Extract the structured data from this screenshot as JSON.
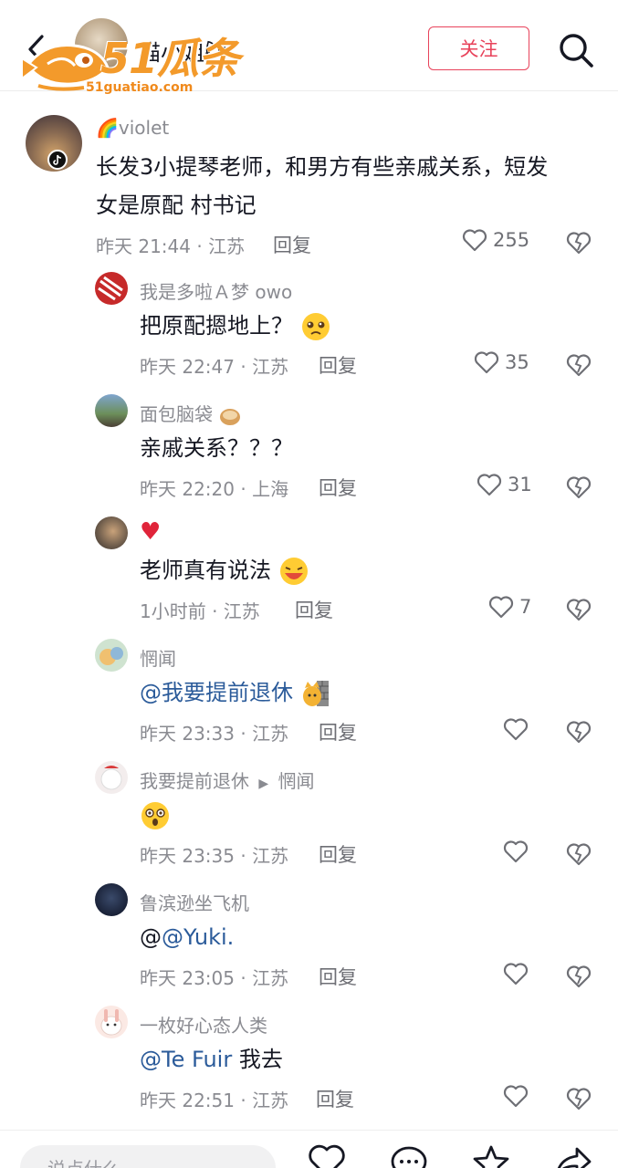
{
  "header": {
    "name": "猫小姐🐱",
    "follow_label": "关注",
    "watermark_big": "51瓜条",
    "watermark_small": "51guatiao.com"
  },
  "comments": [
    {
      "user": "🌈violet",
      "text": "长发3小提琴老师，和男方有些亲戚关系，短发",
      "text2": "女是原配 村书记",
      "time": "昨天 21:44 · 江苏",
      "reply": "回复",
      "likes": "255"
    },
    {
      "user": "我是多啦Ａ梦 owo",
      "text": "把原配摁地上？",
      "time": "昨天 22:47 · 江苏",
      "reply": "回复",
      "likes": "35"
    },
    {
      "user": "面包脑袋",
      "text": "亲戚关系？？？",
      "time": "昨天 22:20 · 上海",
      "reply": "回复",
      "likes": "31"
    },
    {
      "user": "♥",
      "text": "老师真有说法",
      "time": "1小时前 · 江苏",
      "reply": "回复",
      "likes": "7"
    },
    {
      "user": "惘闻",
      "mention": "@我要提前退休",
      "time": "昨天 23:33 · 江苏",
      "reply": "回复",
      "likes": ""
    },
    {
      "user": "我要提前退休",
      "reply_to": "惘闻",
      "time": "昨天 23:35 · 江苏",
      "reply": "回复",
      "likes": ""
    },
    {
      "user": "鲁滨逊坐飞机",
      "text_prefix": "@",
      "mention": "@Yuki.",
      "time": "昨天 23:05 · 江苏",
      "reply": "回复",
      "likes": ""
    },
    {
      "user": "一枚好心态人类",
      "mention": "@Te Fuir",
      "text": " 我去",
      "time": "昨天 22:51 · 江苏",
      "reply": "回复",
      "likes": ""
    }
  ],
  "bottom": {
    "placeholder": "说点什么..."
  },
  "colors": {
    "accent": "#e8435b",
    "mention": "#2b5b9a",
    "meta": "#8a8b91",
    "watermark": "#f39a2b"
  },
  "icons": [
    "back-icon",
    "search-icon",
    "heart-icon",
    "broken-heart-icon",
    "comment-icon",
    "star-icon",
    "share-icon",
    "tiktok-badge-icon"
  ]
}
